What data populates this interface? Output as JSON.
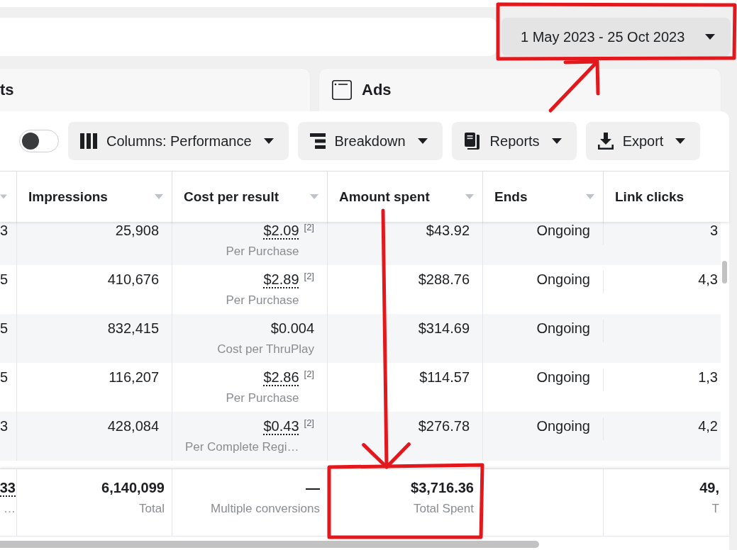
{
  "date_range": {
    "label": "1 May 2023 - 25 Oct 2023"
  },
  "tabs": [
    {
      "label": "ts",
      "kind": "plain",
      "selected": false
    },
    {
      "label": "Ads",
      "kind": "with_icon",
      "selected": false
    }
  ],
  "toolbar": {
    "toggle": {
      "on": false
    },
    "buttons": [
      {
        "label": "Columns: Performance",
        "kind": "columns"
      },
      {
        "label": "Breakdown",
        "kind": "breakdown"
      },
      {
        "label": "Reports",
        "kind": "reports"
      },
      {
        "label": "Export",
        "kind": "export"
      }
    ]
  },
  "table": {
    "columns": [
      {
        "sortable": true
      },
      {
        "label": "Impressions",
        "sortable": true
      },
      {
        "label": "Cost per result",
        "sortable": true
      },
      {
        "label": "Amount spent",
        "sortable": true
      },
      {
        "label": "Ends",
        "sortable": true
      },
      {
        "label": "Link clicks",
        "sortable": false
      }
    ],
    "rows": [
      {
        "column_1": "3",
        "impressions": "25,908",
        "cost_per_result": {
          "value": "$2.09",
          "underlined": true,
          "footnote": "[2]",
          "label": "Per Purchase"
        },
        "amount_spent": "$43.92",
        "ends": "Ongoing",
        "link_clicks": "3"
      },
      {
        "column_1": "5",
        "impressions": "410,676",
        "cost_per_result": {
          "value": "$2.89",
          "underlined": true,
          "footnote": "[2]",
          "label": "Per Purchase"
        },
        "amount_spent": "$288.76",
        "ends": "Ongoing",
        "link_clicks": "4,3"
      },
      {
        "column_1": "5",
        "impressions": "832,415",
        "cost_per_result": {
          "value": "$0.004",
          "underlined": false,
          "label": "Cost per ThruPlay"
        },
        "amount_spent": "$314.69",
        "ends": "Ongoing"
      },
      {
        "column_1": "5",
        "impressions": "116,207",
        "cost_per_result": {
          "value": "$2.86",
          "underlined": true,
          "footnote": "[2]",
          "label": "Per Purchase"
        },
        "amount_spent": "$114.57",
        "ends": "Ongoing",
        "link_clicks": "1,3"
      },
      {
        "column_1": "3",
        "impressions": "428,084",
        "cost_per_result": {
          "value": "$0.43",
          "underlined": true,
          "footnote": "[2]",
          "label": "Per Complete Regi…"
        },
        "amount_spent": "$276.78",
        "ends": "Ongoing",
        "link_clicks": "4,2"
      }
    ],
    "totals": {
      "column_1": {
        "value": "33",
        "underlined": true,
        "label": "…"
      },
      "impressions": {
        "value": "6,140,099",
        "underlined": false,
        "label": "Total"
      },
      "cost_per_result": {
        "value": "—",
        "underlined": false,
        "label": "Multiple conversions"
      },
      "amount_spent": {
        "value": "$3,716.36",
        "underlined": false,
        "label": "Total Spent"
      },
      "link_clicks": {
        "value": "49,",
        "underlined": false,
        "label": "T"
      }
    }
  },
  "annotations": [
    {
      "kind": "frame"
    },
    {
      "kind": "arrow"
    },
    {
      "kind": "arrow"
    },
    {
      "kind": "frame"
    }
  ]
}
